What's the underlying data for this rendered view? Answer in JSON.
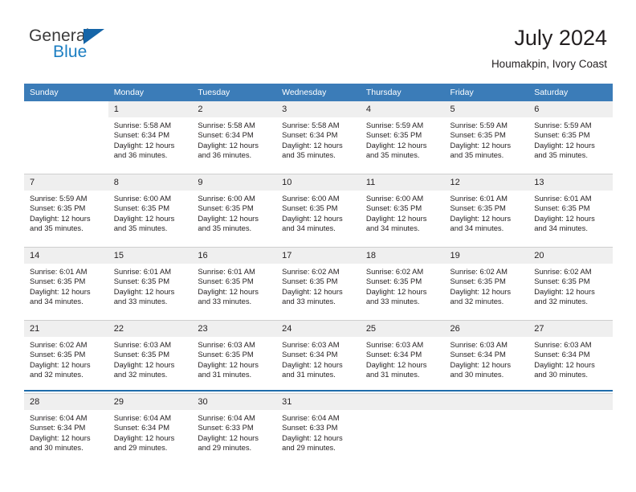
{
  "brand": {
    "name_top": "General",
    "name_bottom": "Blue",
    "triangle_color": "#1565a8",
    "text_top_color": "#3b3b3b",
    "text_bottom_color": "#1b7ec2"
  },
  "header": {
    "title": "July 2024",
    "subtitle": "Houmakpin, Ivory Coast"
  },
  "theme": {
    "header_row_bg": "#3b7cb8",
    "daynum_bg": "#efefef",
    "grid_line": "#cfcfcf",
    "bottom_rule": "#1f6cab",
    "text": "#231f20"
  },
  "labels": {
    "sunrise_prefix": "Sunrise:",
    "sunset_prefix": "Sunset:",
    "daylight_prefix": "Daylight:"
  },
  "weekday_headers": [
    "Sunday",
    "Monday",
    "Tuesday",
    "Wednesday",
    "Thursday",
    "Friday",
    "Saturday"
  ],
  "weeks": [
    [
      {
        "day": "",
        "blank": true,
        "sunrise": "",
        "sunset": "",
        "daylight_1": "",
        "daylight_2": ""
      },
      {
        "day": "1",
        "sunrise": "Sunrise: 5:58 AM",
        "sunset": "Sunset: 6:34 PM",
        "daylight_1": "Daylight: 12 hours",
        "daylight_2": "and 36 minutes."
      },
      {
        "day": "2",
        "sunrise": "Sunrise: 5:58 AM",
        "sunset": "Sunset: 6:34 PM",
        "daylight_1": "Daylight: 12 hours",
        "daylight_2": "and 36 minutes."
      },
      {
        "day": "3",
        "sunrise": "Sunrise: 5:58 AM",
        "sunset": "Sunset: 6:34 PM",
        "daylight_1": "Daylight: 12 hours",
        "daylight_2": "and 35 minutes."
      },
      {
        "day": "4",
        "sunrise": "Sunrise: 5:59 AM",
        "sunset": "Sunset: 6:35 PM",
        "daylight_1": "Daylight: 12 hours",
        "daylight_2": "and 35 minutes."
      },
      {
        "day": "5",
        "sunrise": "Sunrise: 5:59 AM",
        "sunset": "Sunset: 6:35 PM",
        "daylight_1": "Daylight: 12 hours",
        "daylight_2": "and 35 minutes."
      },
      {
        "day": "6",
        "sunrise": "Sunrise: 5:59 AM",
        "sunset": "Sunset: 6:35 PM",
        "daylight_1": "Daylight: 12 hours",
        "daylight_2": "and 35 minutes."
      }
    ],
    [
      {
        "day": "7",
        "sunrise": "Sunrise: 5:59 AM",
        "sunset": "Sunset: 6:35 PM",
        "daylight_1": "Daylight: 12 hours",
        "daylight_2": "and 35 minutes."
      },
      {
        "day": "8",
        "sunrise": "Sunrise: 6:00 AM",
        "sunset": "Sunset: 6:35 PM",
        "daylight_1": "Daylight: 12 hours",
        "daylight_2": "and 35 minutes."
      },
      {
        "day": "9",
        "sunrise": "Sunrise: 6:00 AM",
        "sunset": "Sunset: 6:35 PM",
        "daylight_1": "Daylight: 12 hours",
        "daylight_2": "and 35 minutes."
      },
      {
        "day": "10",
        "sunrise": "Sunrise: 6:00 AM",
        "sunset": "Sunset: 6:35 PM",
        "daylight_1": "Daylight: 12 hours",
        "daylight_2": "and 34 minutes."
      },
      {
        "day": "11",
        "sunrise": "Sunrise: 6:00 AM",
        "sunset": "Sunset: 6:35 PM",
        "daylight_1": "Daylight: 12 hours",
        "daylight_2": "and 34 minutes."
      },
      {
        "day": "12",
        "sunrise": "Sunrise: 6:01 AM",
        "sunset": "Sunset: 6:35 PM",
        "daylight_1": "Daylight: 12 hours",
        "daylight_2": "and 34 minutes."
      },
      {
        "day": "13",
        "sunrise": "Sunrise: 6:01 AM",
        "sunset": "Sunset: 6:35 PM",
        "daylight_1": "Daylight: 12 hours",
        "daylight_2": "and 34 minutes."
      }
    ],
    [
      {
        "day": "14",
        "sunrise": "Sunrise: 6:01 AM",
        "sunset": "Sunset: 6:35 PM",
        "daylight_1": "Daylight: 12 hours",
        "daylight_2": "and 34 minutes."
      },
      {
        "day": "15",
        "sunrise": "Sunrise: 6:01 AM",
        "sunset": "Sunset: 6:35 PM",
        "daylight_1": "Daylight: 12 hours",
        "daylight_2": "and 33 minutes."
      },
      {
        "day": "16",
        "sunrise": "Sunrise: 6:01 AM",
        "sunset": "Sunset: 6:35 PM",
        "daylight_1": "Daylight: 12 hours",
        "daylight_2": "and 33 minutes."
      },
      {
        "day": "17",
        "sunrise": "Sunrise: 6:02 AM",
        "sunset": "Sunset: 6:35 PM",
        "daylight_1": "Daylight: 12 hours",
        "daylight_2": "and 33 minutes."
      },
      {
        "day": "18",
        "sunrise": "Sunrise: 6:02 AM",
        "sunset": "Sunset: 6:35 PM",
        "daylight_1": "Daylight: 12 hours",
        "daylight_2": "and 33 minutes."
      },
      {
        "day": "19",
        "sunrise": "Sunrise: 6:02 AM",
        "sunset": "Sunset: 6:35 PM",
        "daylight_1": "Daylight: 12 hours",
        "daylight_2": "and 32 minutes."
      },
      {
        "day": "20",
        "sunrise": "Sunrise: 6:02 AM",
        "sunset": "Sunset: 6:35 PM",
        "daylight_1": "Daylight: 12 hours",
        "daylight_2": "and 32 minutes."
      }
    ],
    [
      {
        "day": "21",
        "sunrise": "Sunrise: 6:02 AM",
        "sunset": "Sunset: 6:35 PM",
        "daylight_1": "Daylight: 12 hours",
        "daylight_2": "and 32 minutes."
      },
      {
        "day": "22",
        "sunrise": "Sunrise: 6:03 AM",
        "sunset": "Sunset: 6:35 PM",
        "daylight_1": "Daylight: 12 hours",
        "daylight_2": "and 32 minutes."
      },
      {
        "day": "23",
        "sunrise": "Sunrise: 6:03 AM",
        "sunset": "Sunset: 6:35 PM",
        "daylight_1": "Daylight: 12 hours",
        "daylight_2": "and 31 minutes."
      },
      {
        "day": "24",
        "sunrise": "Sunrise: 6:03 AM",
        "sunset": "Sunset: 6:34 PM",
        "daylight_1": "Daylight: 12 hours",
        "daylight_2": "and 31 minutes."
      },
      {
        "day": "25",
        "sunrise": "Sunrise: 6:03 AM",
        "sunset": "Sunset: 6:34 PM",
        "daylight_1": "Daylight: 12 hours",
        "daylight_2": "and 31 minutes."
      },
      {
        "day": "26",
        "sunrise": "Sunrise: 6:03 AM",
        "sunset": "Sunset: 6:34 PM",
        "daylight_1": "Daylight: 12 hours",
        "daylight_2": "and 30 minutes."
      },
      {
        "day": "27",
        "sunrise": "Sunrise: 6:03 AM",
        "sunset": "Sunset: 6:34 PM",
        "daylight_1": "Daylight: 12 hours",
        "daylight_2": "and 30 minutes."
      }
    ],
    [
      {
        "day": "28",
        "sunrise": "Sunrise: 6:04 AM",
        "sunset": "Sunset: 6:34 PM",
        "daylight_1": "Daylight: 12 hours",
        "daylight_2": "and 30 minutes."
      },
      {
        "day": "29",
        "sunrise": "Sunrise: 6:04 AM",
        "sunset": "Sunset: 6:34 PM",
        "daylight_1": "Daylight: 12 hours",
        "daylight_2": "and 29 minutes."
      },
      {
        "day": "30",
        "sunrise": "Sunrise: 6:04 AM",
        "sunset": "Sunset: 6:33 PM",
        "daylight_1": "Daylight: 12 hours",
        "daylight_2": "and 29 minutes."
      },
      {
        "day": "31",
        "sunrise": "Sunrise: 6:04 AM",
        "sunset": "Sunset: 6:33 PM",
        "daylight_1": "Daylight: 12 hours",
        "daylight_2": "and 29 minutes."
      },
      {
        "day": "",
        "blank": true,
        "sunrise": "",
        "sunset": "",
        "daylight_1": "",
        "daylight_2": ""
      },
      {
        "day": "",
        "blank": true,
        "sunrise": "",
        "sunset": "",
        "daylight_1": "",
        "daylight_2": ""
      },
      {
        "day": "",
        "blank": true,
        "sunrise": "",
        "sunset": "",
        "daylight_1": "",
        "daylight_2": ""
      }
    ]
  ]
}
